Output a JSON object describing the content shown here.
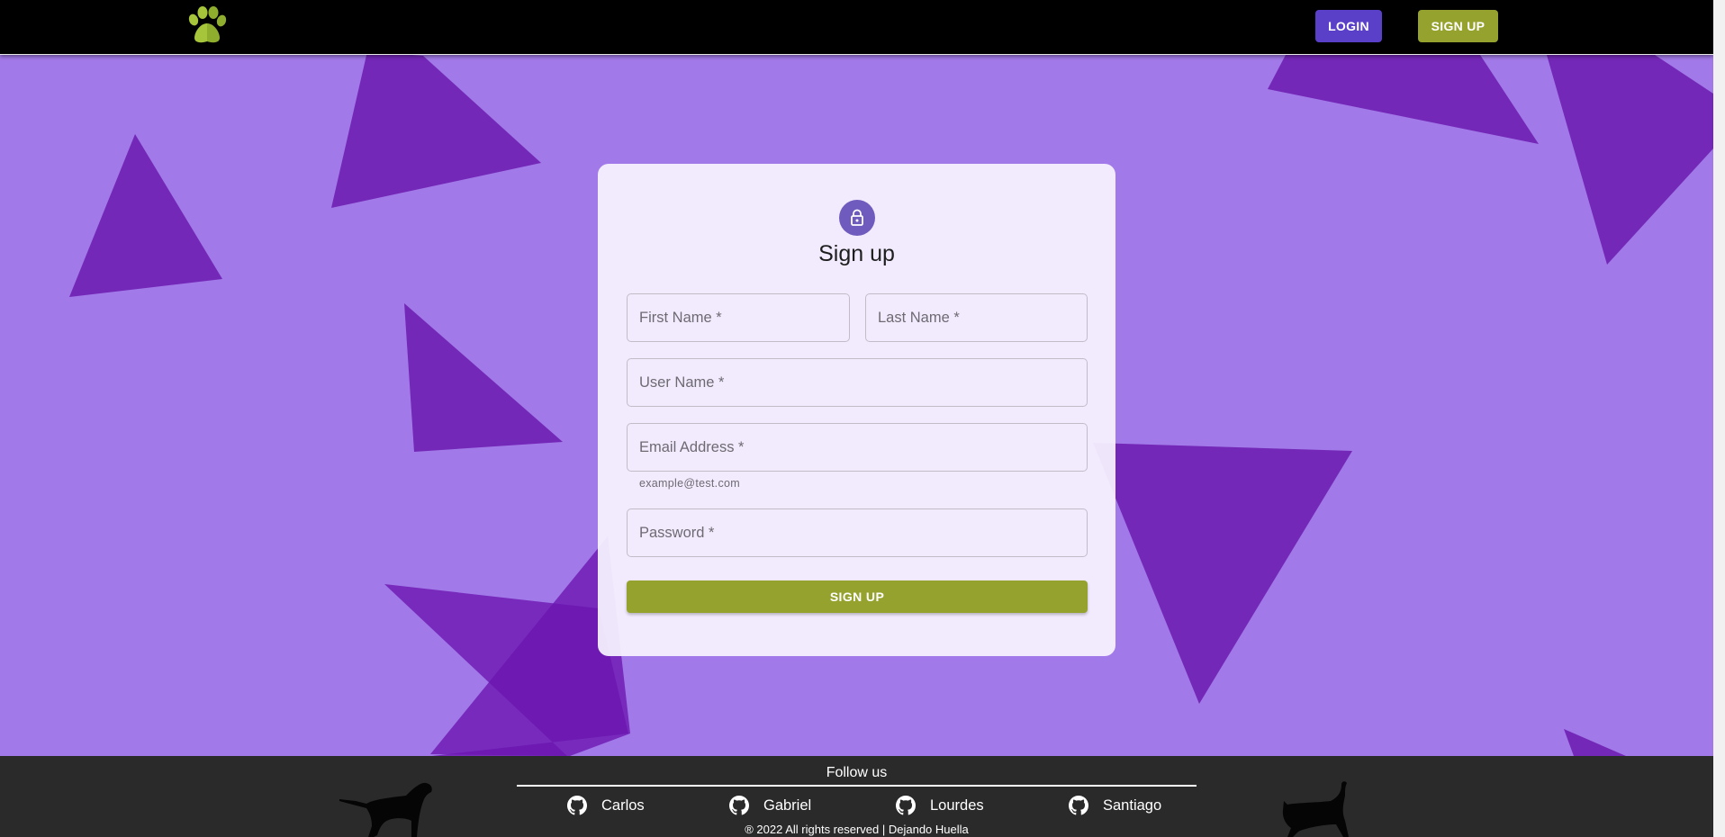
{
  "header": {
    "logo_alt": "paw-logo",
    "login_label": "LOGIN",
    "signup_label": "SIGN UP"
  },
  "colors": {
    "background": "#a279e8",
    "triangle": "#7428b8",
    "brand_green": "#96a22e",
    "login_purple": "#5a3fc9",
    "lock_purple": "#6f5bbd",
    "footer": "#2a2a2a"
  },
  "form": {
    "icon": "lock-icon",
    "title": "Sign up",
    "fields": {
      "first_name": {
        "placeholder": "First Name *",
        "value": ""
      },
      "last_name": {
        "placeholder": "Last Name *",
        "value": ""
      },
      "user_name": {
        "placeholder": "User Name *",
        "value": ""
      },
      "email": {
        "placeholder": "Email Address *",
        "value": "",
        "helper": "example@test.com"
      },
      "password": {
        "placeholder": "Password *",
        "value": ""
      }
    },
    "submit_label": "SIGN UP"
  },
  "footer": {
    "heading": "Follow us",
    "links": [
      {
        "icon": "github-icon",
        "label": "Carlos"
      },
      {
        "icon": "github-icon",
        "label": "Gabriel"
      },
      {
        "icon": "github-icon",
        "label": "Lourdes"
      },
      {
        "icon": "github-icon",
        "label": "Santiago"
      }
    ],
    "copyright": "® 2022 All rights reserved | Dejando Huella"
  }
}
